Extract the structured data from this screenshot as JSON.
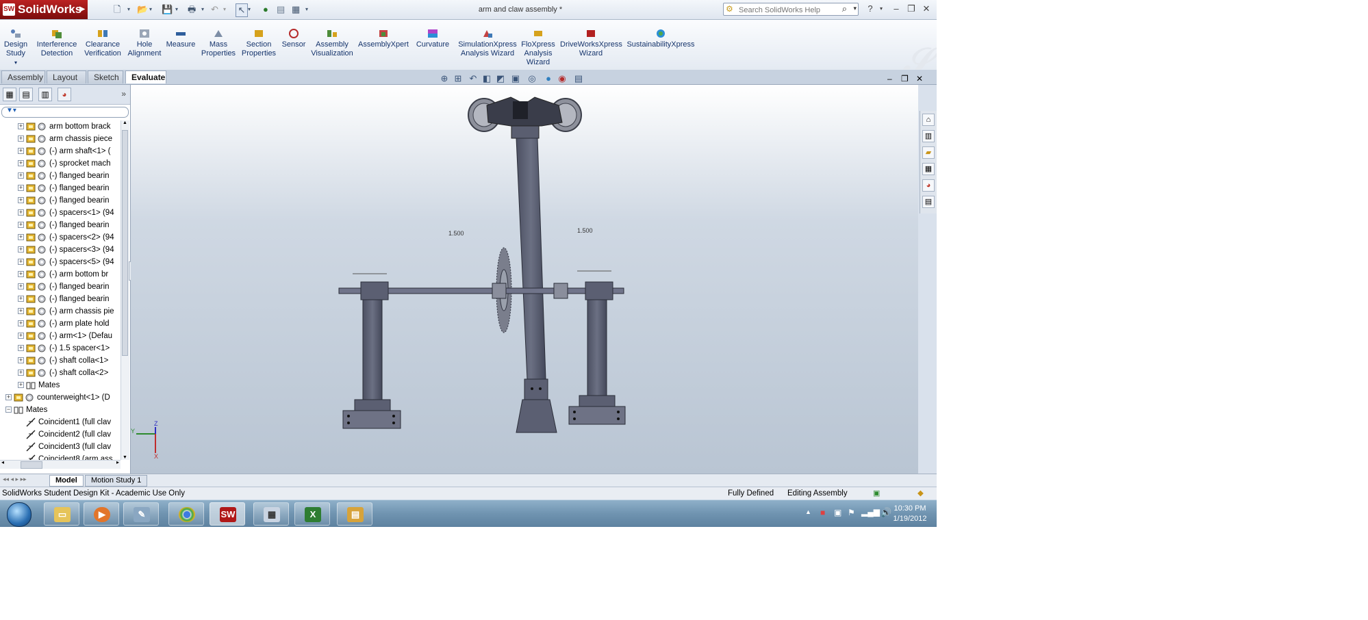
{
  "app": {
    "logo_text": "SolidWorks",
    "document_title": "arm and claw assembly *",
    "search_placeholder": "Search SolidWorks Help"
  },
  "ribbon": {
    "items": [
      {
        "label": "Design Study",
        "icon": "design-study-icon"
      },
      {
        "label": "Interference Detection",
        "icon": "interference-icon"
      },
      {
        "label": "Clearance Verification",
        "icon": "clearance-icon"
      },
      {
        "label": "Hole Alignment",
        "icon": "hole-alignment-icon"
      },
      {
        "label": "Measure",
        "icon": "measure-icon"
      },
      {
        "label": "Mass Properties",
        "icon": "mass-properties-icon"
      },
      {
        "label": "Section Properties",
        "icon": "section-properties-icon"
      },
      {
        "label": "Sensor",
        "icon": "sensor-icon"
      },
      {
        "label": "Assembly Visualization",
        "icon": "assembly-visualization-icon"
      },
      {
        "label": "AssemblyXpert",
        "icon": "assemblyxpert-icon"
      },
      {
        "label": "Curvature",
        "icon": "curvature-icon"
      },
      {
        "label": "SimulationXpress Analysis Wizard",
        "icon": "simulationxpress-icon"
      },
      {
        "label": "FloXpress Analysis Wizard",
        "icon": "floxpress-icon"
      },
      {
        "label": "DriveWorksXpress Wizard",
        "icon": "driveworks-icon"
      },
      {
        "label": "SustainabilityXpress",
        "icon": "sustainability-icon"
      }
    ]
  },
  "tabs": [
    "Assembly",
    "Layout",
    "Sketch",
    "Evaluate"
  ],
  "tree": {
    "items": [
      {
        "label": "arm bottom brack"
      },
      {
        "label": "arm chassis piece"
      },
      {
        "label": "(-) arm shaft<1> ("
      },
      {
        "label": "(-) sprocket mach"
      },
      {
        "label": "(-) flanged bearin"
      },
      {
        "label": "(-) flanged bearin"
      },
      {
        "label": "(-) flanged bearin"
      },
      {
        "label": "(-) spacers<1> (94"
      },
      {
        "label": "(-) flanged bearin"
      },
      {
        "label": "(-) spacers<2> (94"
      },
      {
        "label": "(-) spacers<3> (94"
      },
      {
        "label": "(-) spacers<5> (94"
      },
      {
        "label": "(-) arm bottom br"
      },
      {
        "label": "(-) flanged bearin"
      },
      {
        "label": "(-) flanged bearin"
      },
      {
        "label": "(-) arm chassis pie"
      },
      {
        "label": "(-) arm plate hold"
      },
      {
        "label": "(-) arm<1> (Defau"
      },
      {
        "label": "(-) 1.5 spacer<1>"
      },
      {
        "label": "(-) shaft colla<1>"
      },
      {
        "label": "(-) shaft colla<2>"
      },
      {
        "label": "Mates"
      },
      {
        "label": "counterweight<1> (D"
      },
      {
        "label": "Mates"
      },
      {
        "label": "Coincident1 (full clav"
      },
      {
        "label": "Coincident2 (full clav"
      },
      {
        "label": "Coincident3 (full clav"
      },
      {
        "label": "Coincident8 (arm ass"
      }
    ]
  },
  "viewport": {
    "dimension_left": "1.500",
    "dimension_right": "1.500",
    "triad_y": "Y",
    "triad_z": "Z",
    "triad_x": "X"
  },
  "model_tabs": [
    "Model",
    "Motion Study 1"
  ],
  "status": {
    "left": "SolidWorks Student Design Kit - Academic Use Only",
    "fully_defined": "Fully Defined",
    "editing": "Editing Assembly"
  },
  "taskbar": {
    "time": "10:30 PM",
    "date": "1/19/2012"
  },
  "colors": {
    "model_body": "#5b5f72",
    "model_edge": "#2a2d38",
    "logo_red": "#b01818"
  }
}
